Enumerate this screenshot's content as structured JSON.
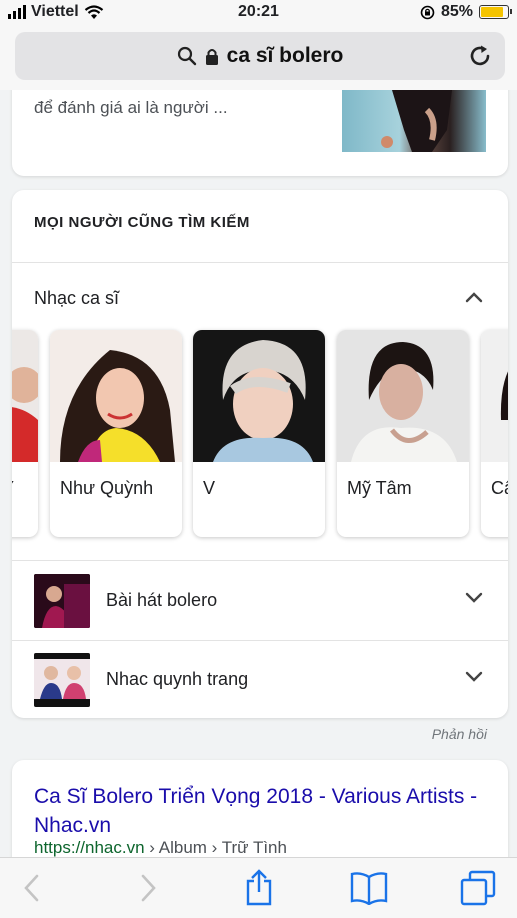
{
  "status_bar": {
    "carrier": "Viettel",
    "time": "20:21",
    "battery_percent": "85%",
    "battery_level": 0.85
  },
  "address_bar": {
    "url_text": "ca sĩ bolero"
  },
  "top_result": {
    "snippet": "để đánh giá ai là người ..."
  },
  "people_also_search": {
    "title": "MỌI NGƯỜI CŨNG TÌM KIẾM",
    "section_label": "Nhạc ca sĩ",
    "artists": [
      {
        "name": "Ỹ"
      },
      {
        "name": "Như Quỳnh"
      },
      {
        "name": "V"
      },
      {
        "name": "Mỹ Tâm"
      },
      {
        "name": "Cẩ"
      }
    ],
    "rows": [
      {
        "label": "Bài hát bolero"
      },
      {
        "label": "Nhac quynh trang"
      }
    ]
  },
  "feedback_label": "Phản hồi",
  "result": {
    "title": "Ca Sĩ Bolero Triển Vọng 2018 - Various Artists - Nhac.vn",
    "url": "https://nhac.vn",
    "breadcrumb": " › Album › Trữ Tình"
  },
  "colors": {
    "link": "#1a0dab",
    "url_green": "#0d652d",
    "ios_blue": "#1a73e8",
    "battery": "#f5c400"
  },
  "toolbar": {
    "icons": [
      "back-icon",
      "forward-icon",
      "share-icon",
      "bookmarks-icon",
      "tabs-icon"
    ]
  }
}
